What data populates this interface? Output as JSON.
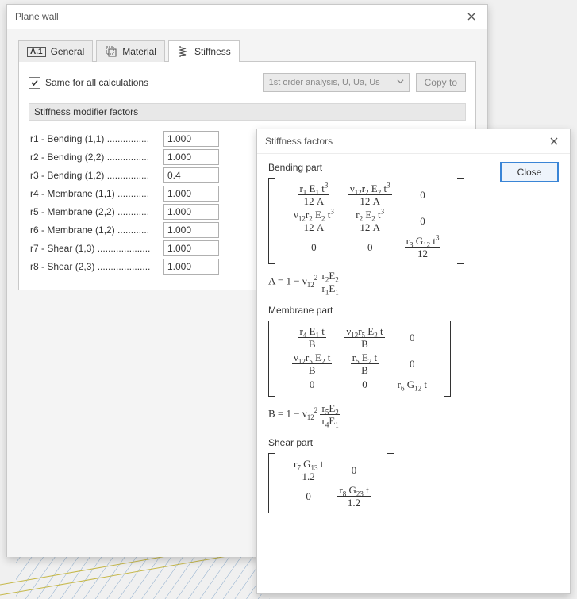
{
  "plane_wall": {
    "title": "Plane wall",
    "tabs": {
      "general": {
        "code": "A.1",
        "label": "General"
      },
      "material": {
        "label": "Material"
      },
      "stiffness": {
        "label": "Stiffness"
      }
    },
    "same_for_all": {
      "label": "Same for all calculations",
      "checked": true
    },
    "analysis_combo": {
      "selected": "1st order analysis, U, Ua, Us"
    },
    "copy_button": "Copy to",
    "section_title": "Stiffness modifier factors",
    "factors": [
      {
        "label": "r1 - Bending (1,1) ................",
        "value": "1.000"
      },
      {
        "label": "r2 - Bending (2,2) ................",
        "value": "1.000"
      },
      {
        "label": "r3 - Bending (1,2) ................",
        "value": "0.4"
      },
      {
        "label": "r4 - Membrane (1,1) ............",
        "value": "1.000"
      },
      {
        "label": "r5 - Membrane (2,2) ............",
        "value": "1.000"
      },
      {
        "label": "r6 - Membrane (1,2) ............",
        "value": "1.000"
      },
      {
        "label": "r7 - Shear (1,3) ....................",
        "value": "1.000"
      },
      {
        "label": "r8 - Shear (2,3) ....................",
        "value": "1.000"
      }
    ]
  },
  "stiffness_popup": {
    "title": "Stiffness factors",
    "close_label": "Close",
    "sections": {
      "bending_title": "Bending part",
      "membrane_title": "Membrane part",
      "shear_title": "Shear part"
    }
  }
}
